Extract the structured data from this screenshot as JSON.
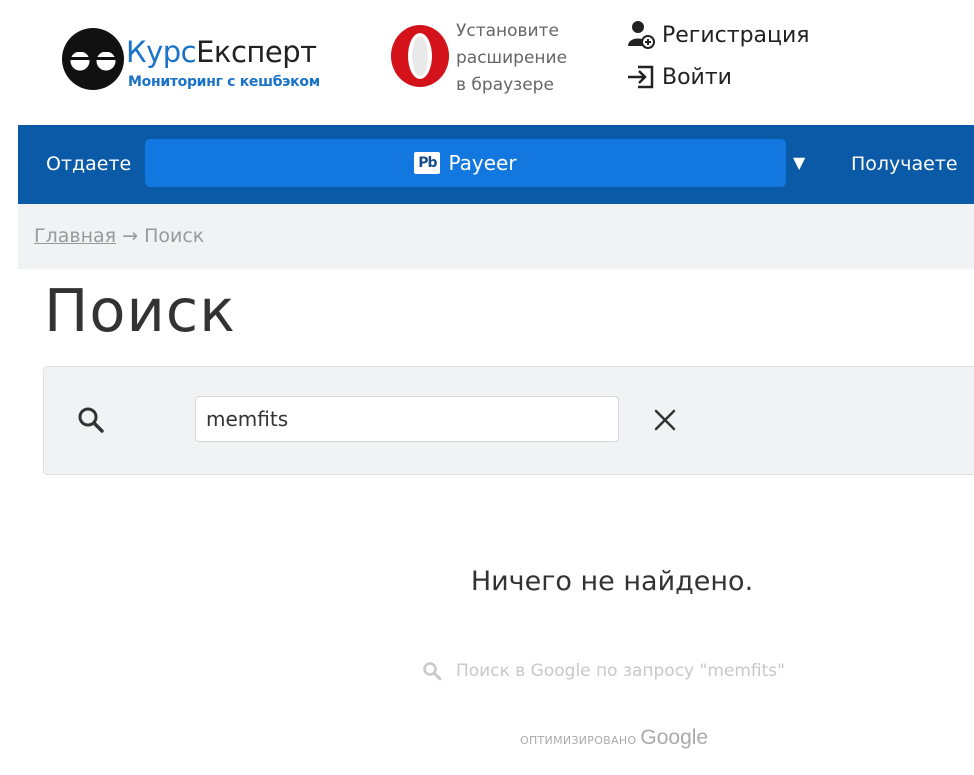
{
  "header": {
    "logo": {
      "title_part1": "Курс",
      "title_part2": "Експерт",
      "subtitle": "Мониторинг с кешбэком"
    },
    "opera_promo": {
      "text": "Установите\nрасширение\nв браузере"
    },
    "auth": {
      "register_label": "Регистрация",
      "login_label": "Войти"
    }
  },
  "exchange_bar": {
    "give_label": "Отдаете",
    "give_currency": {
      "icon_text": "Pb",
      "label": "Payeer"
    },
    "dropdown_glyph": "▼",
    "get_label": "Получаете"
  },
  "breadcrumb": {
    "home": "Главная",
    "separator": "→",
    "current": "Поиск"
  },
  "page": {
    "title": "Поиск"
  },
  "search": {
    "value": "memfits",
    "clear_glyph": "✕"
  },
  "results": {
    "empty_message": "Ничего не найдено.",
    "google_search_text": "Поиск в Google по запросу \"memfits\"",
    "optimized_label": "ОПТИМИЗИРОВАНО",
    "google_label": "Google"
  },
  "colors": {
    "brand_blue": "#0b5aa7",
    "select_blue": "#1278e0",
    "logo_blue": "#1a73c8",
    "opera_red": "#d3121b"
  }
}
